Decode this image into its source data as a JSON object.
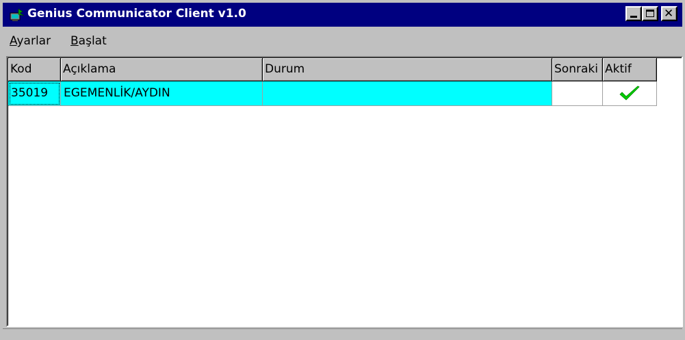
{
  "window": {
    "title": "Genius Communicator Client v1.0",
    "title_bar_color": "#000080"
  },
  "menu": {
    "ayarlar_mnemonic": "A",
    "ayarlar_rest": "yarlar",
    "baslat_mnemonic": "B",
    "baslat_rest": "aşlat"
  },
  "grid": {
    "columns": [
      "Kod",
      "Açıklama",
      "Durum",
      "Sonraki",
      "Aktif"
    ],
    "rows": [
      {
        "kod": "35019",
        "aciklama": "EGEMENLİK/AYDIN",
        "durum": "",
        "sonraki": "",
        "aktif": "check-icon"
      }
    ],
    "selection_color": "#00ffff",
    "check_color": "#00cc00"
  }
}
